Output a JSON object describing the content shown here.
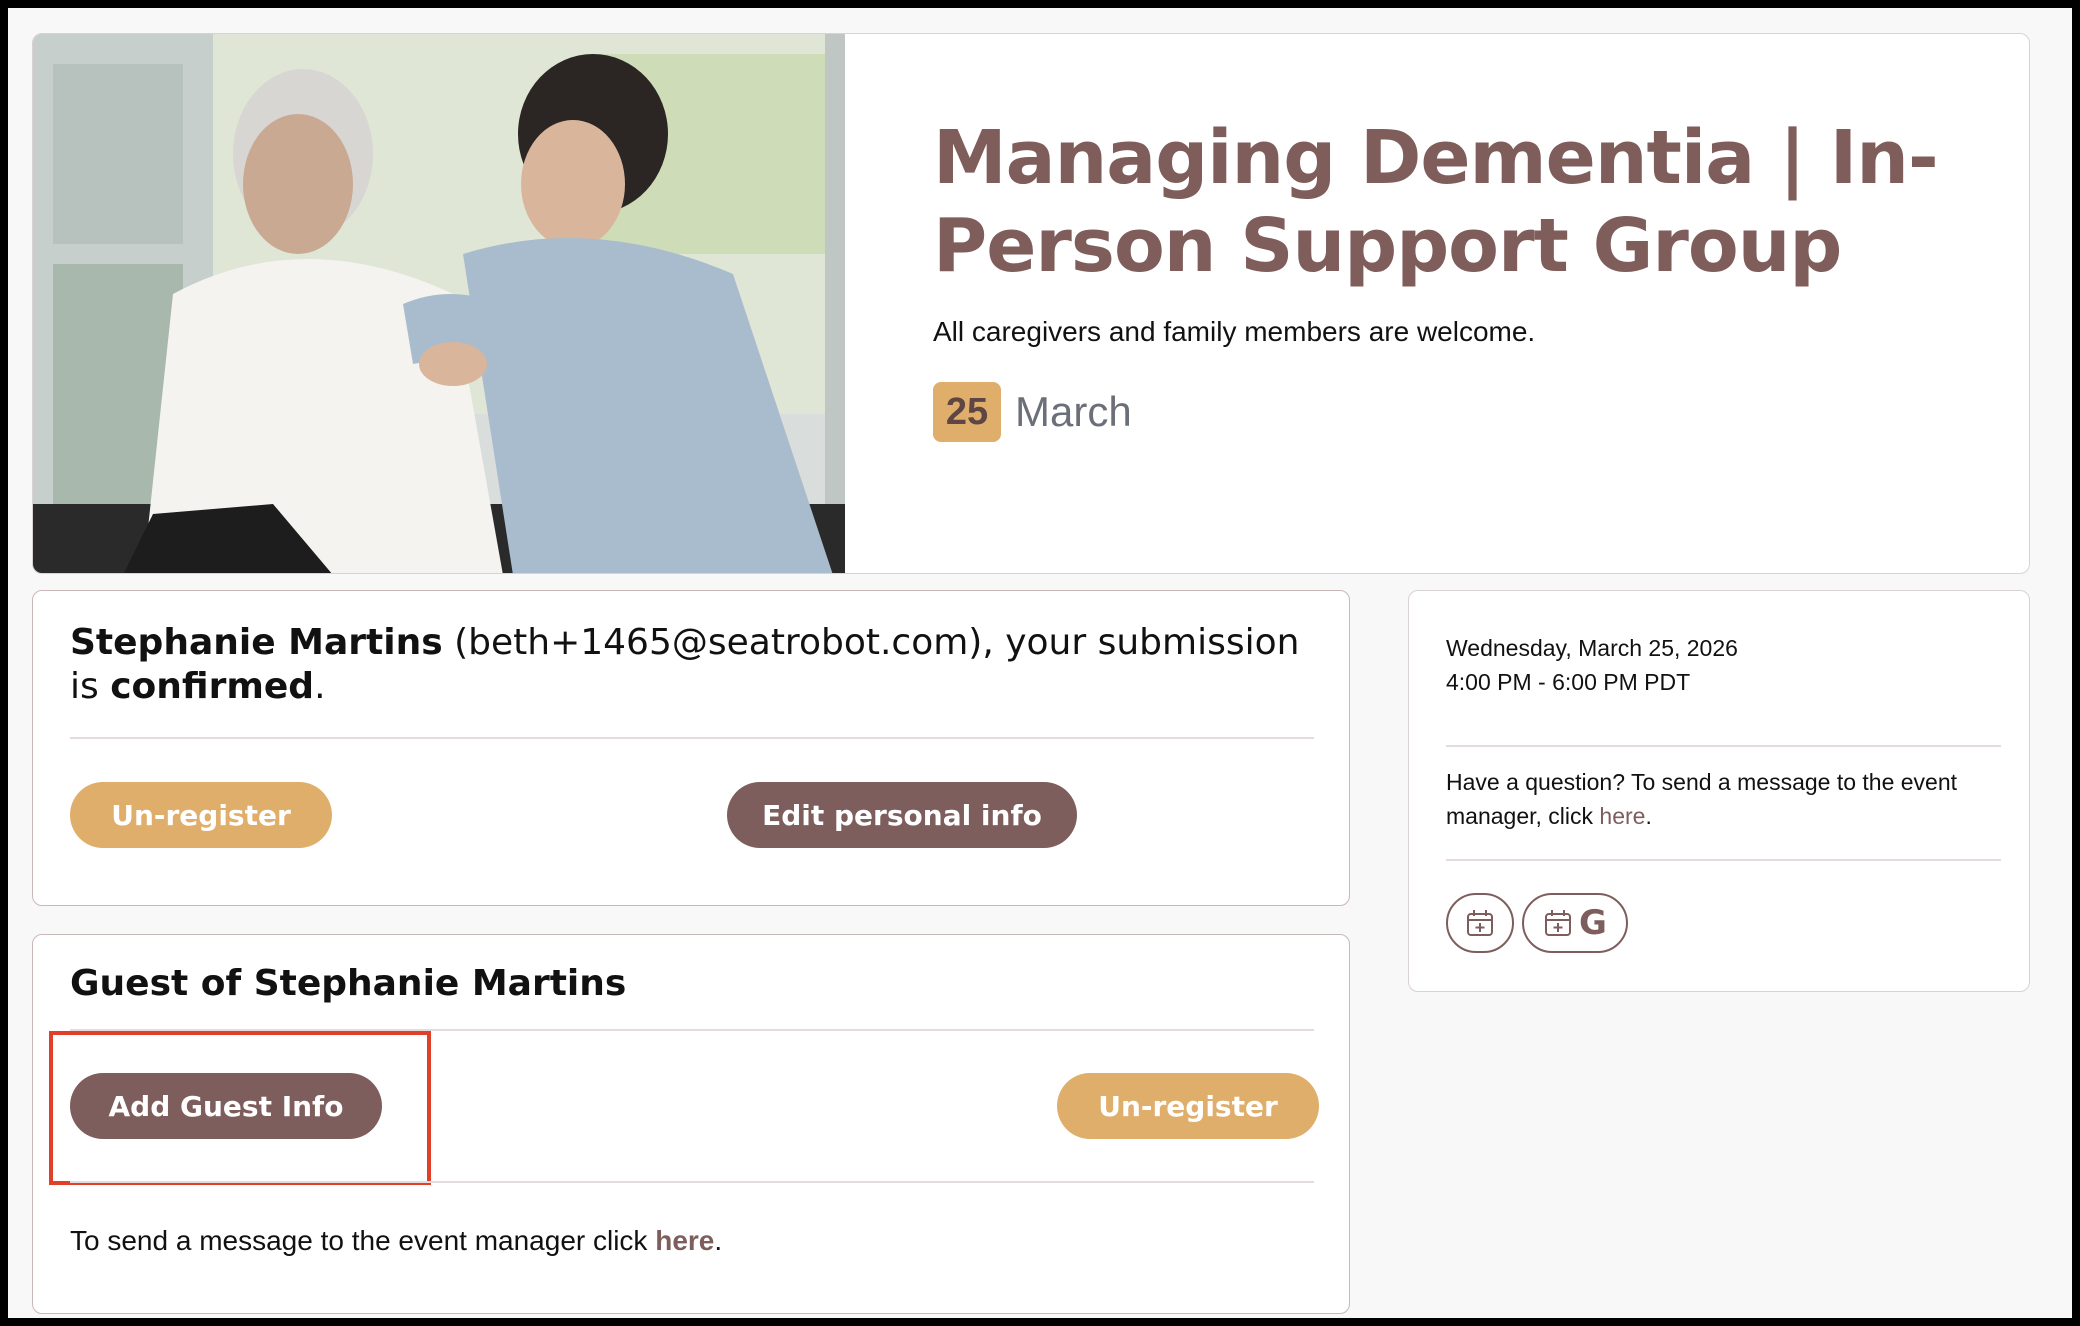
{
  "event": {
    "title": "Managing Dementia | In-Person Support Group",
    "subtitle": "All caregivers and family members are welcome.",
    "day": "25",
    "month": "March"
  },
  "confirmation": {
    "name": "Stephanie Martins",
    "email_text": "(beth+1465@seatrobot.com), your submission is",
    "status": "confirmed",
    "period": ".",
    "unregister_label": "Un-register",
    "edit_label": "Edit personal info"
  },
  "guest": {
    "title": "Guest of Stephanie Martins",
    "add_label": "Add Guest Info",
    "unregister_label": "Un-register",
    "message_prefix": "To send a message to the event manager click ",
    "message_link": "here",
    "message_suffix": "."
  },
  "sidebar": {
    "date": "Wednesday, March 25, 2026",
    "time": "4:00 PM - 6:00 PM PDT",
    "question_prefix": "Have a question? To send a message to the event manager, click ",
    "question_link": "here",
    "question_suffix": ".",
    "google_letter": "G"
  },
  "colors": {
    "brand_brown": "#7d5e5c",
    "brand_gold": "#e0ae6b",
    "highlight": "#e0402a"
  },
  "icons": [
    "calendar-add-icon",
    "google-calendar-icon"
  ]
}
